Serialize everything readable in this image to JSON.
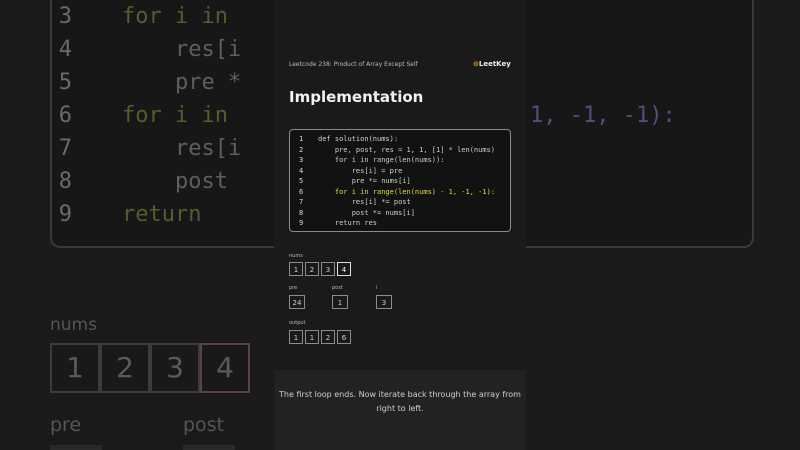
{
  "header": {
    "title": "Leetcode 238: Product of Array Except Self",
    "logo": "LeetKey"
  },
  "heading": "Implementation",
  "code": [
    {
      "n": "1",
      "text": "def solution(nums):"
    },
    {
      "n": "2",
      "text": "    pre, post, res = 1, 1, [1] * len(nums)"
    },
    {
      "n": "3",
      "text": "    for i in range(len(nums)):"
    },
    {
      "n": "4",
      "text": "        res[i] = pre"
    },
    {
      "n": "5",
      "text": "        pre *= nums[i]"
    },
    {
      "n": "6",
      "text": "    for i in range(len(nums) - 1, -1, -1):"
    },
    {
      "n": "7",
      "text": "        res[i] *= post"
    },
    {
      "n": "8",
      "text": "        post *= nums[i]"
    },
    {
      "n": "9",
      "text": "    return res"
    }
  ],
  "nums": {
    "label": "nums",
    "values": [
      "1",
      "2",
      "3",
      "4"
    ]
  },
  "pre": {
    "label": "pre",
    "value": "24"
  },
  "post": {
    "label": "post",
    "value": "1"
  },
  "i": {
    "label": "i",
    "value": "3"
  },
  "output": {
    "label": "output",
    "values": [
      "1",
      "1",
      "2",
      "6"
    ]
  },
  "caption": "The first loop ends. Now iterate back through the array from right to left.",
  "background": {
    "lines": [
      {
        "n": "3",
        "text": "for i in"
      },
      {
        "n": "4",
        "text": "    res[i"
      },
      {
        "n": "5",
        "text": "    pre *"
      },
      {
        "n": "6",
        "text": "for i in"
      },
      {
        "n": "7",
        "text": "    res[i"
      },
      {
        "n": "8",
        "text": "    post"
      },
      {
        "n": "9",
        "text": "return"
      }
    ],
    "right_fragment": "1, -1, -1):",
    "nums_label": "nums",
    "nums": [
      "1",
      "2",
      "3",
      "4"
    ],
    "pre_label": "pre",
    "post_label": "post"
  }
}
